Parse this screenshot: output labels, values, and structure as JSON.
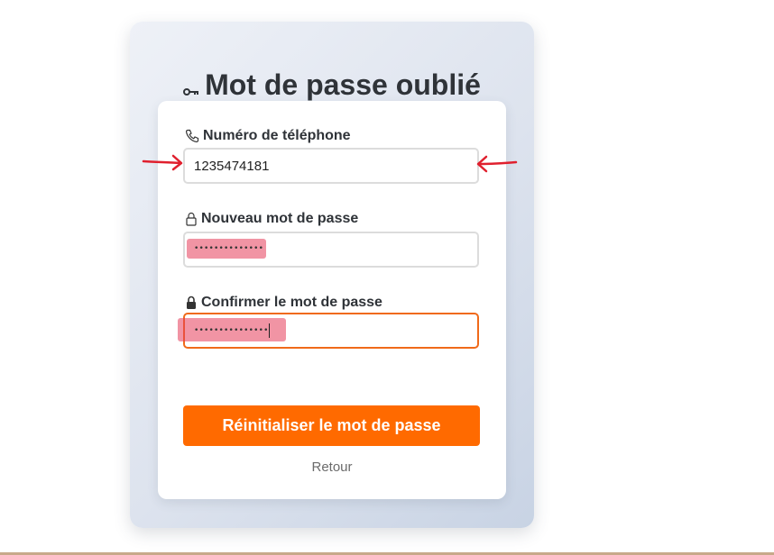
{
  "page": {
    "title": "Mot de passe oublié",
    "title_icon": "key-icon"
  },
  "form": {
    "phone": {
      "label": "Numéro de téléphone",
      "icon": "phone-icon",
      "value": "1235474181"
    },
    "new_password": {
      "label": "Nouveau mot de passe",
      "icon": "lock-open-icon",
      "masked_value": "••••••••••••••"
    },
    "confirm_password": {
      "label": "Confirmer le mot de passe",
      "icon": "lock-closed-icon",
      "masked_value": "•••••••••••••••"
    },
    "submit_label": "Réinitialiser le mot de passe",
    "back_label": "Retour"
  },
  "annotations": {
    "highlight_color": "#e63c5a",
    "arrow_color": "#e0202e"
  },
  "colors": {
    "accent": "#ff6a00",
    "focus_border": "#f06a1a"
  }
}
